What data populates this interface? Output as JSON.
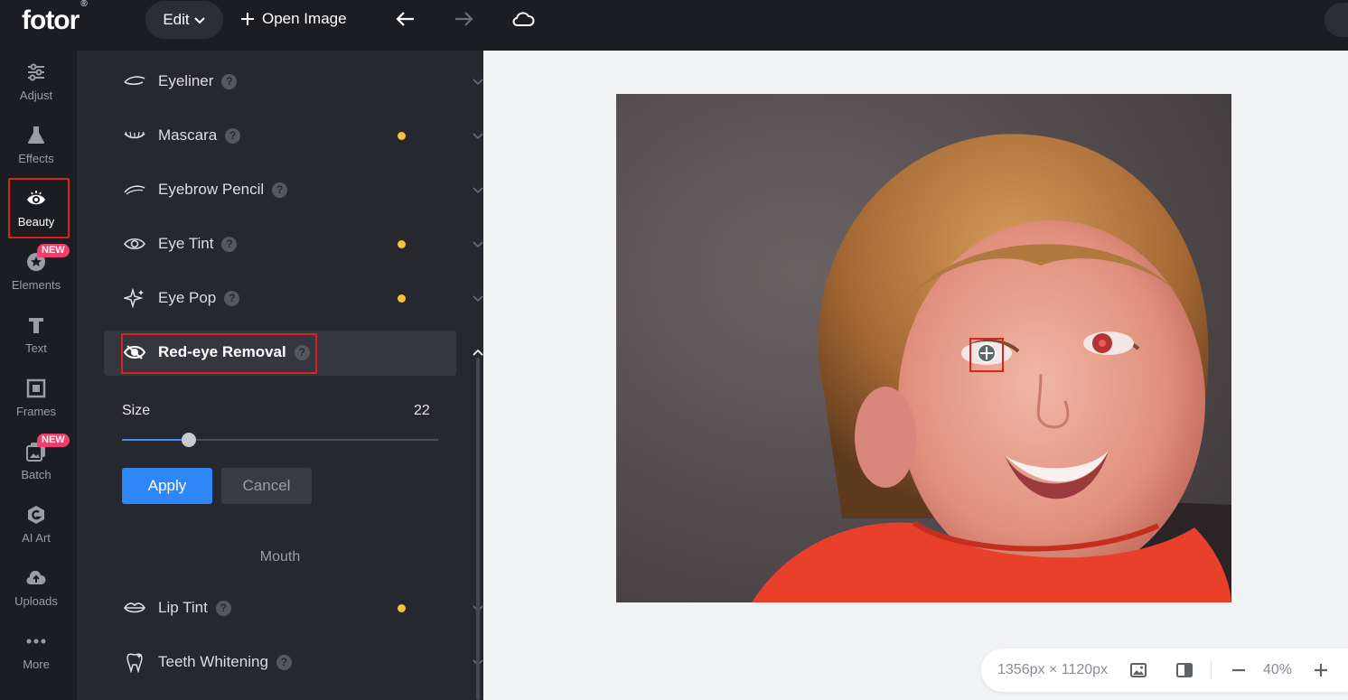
{
  "app": {
    "logo": "fotor",
    "logo_mark": "®"
  },
  "toolbar": {
    "edit_label": "Edit",
    "open_image_label": "Open Image"
  },
  "rail": {
    "items": [
      {
        "label": "Adjust",
        "icon": "sliders-icon"
      },
      {
        "label": "Effects",
        "icon": "flask-icon"
      },
      {
        "label": "Beauty",
        "icon": "eye-icon",
        "active": true
      },
      {
        "label": "Elements",
        "icon": "star-circle-icon",
        "badge": "NEW"
      },
      {
        "label": "Text",
        "icon": "text-t-icon"
      },
      {
        "label": "Frames",
        "icon": "frame-icon"
      },
      {
        "label": "Batch",
        "icon": "batch-images-icon",
        "badge": "NEW"
      },
      {
        "label": "AI Art",
        "icon": "ai-art-icon"
      },
      {
        "label": "Uploads",
        "icon": "cloud-upload-icon"
      },
      {
        "label": "More",
        "icon": "more-dots-icon"
      }
    ]
  },
  "panel": {
    "tools": [
      {
        "label": "Eyeliner",
        "has_dot": false
      },
      {
        "label": "Mascara",
        "has_dot": true
      },
      {
        "label": "Eyebrow Pencil",
        "has_dot": false
      },
      {
        "label": "Eye Tint",
        "has_dot": true
      },
      {
        "label": "Eye Pop",
        "has_dot": true
      },
      {
        "label": "Red-eye Removal",
        "expanded": true
      }
    ],
    "help_glyph": "?",
    "size": {
      "label": "Size",
      "value": "22",
      "fraction": 0.21
    },
    "apply_label": "Apply",
    "cancel_label": "Cancel",
    "mouth_section": "Mouth",
    "mouth_tools": [
      {
        "label": "Lip Tint",
        "has_dot": true
      },
      {
        "label": "Teeth Whitening",
        "has_dot": false
      }
    ]
  },
  "status": {
    "dimensions": "1356px × 1120px",
    "zoom": "40%",
    "zoom_out": "−",
    "zoom_in": "+"
  },
  "colors": {
    "accent": "#2f86f7",
    "highlight_box": "#d8231f",
    "dot": "#f5c141",
    "badge": "#ec3f6b"
  }
}
